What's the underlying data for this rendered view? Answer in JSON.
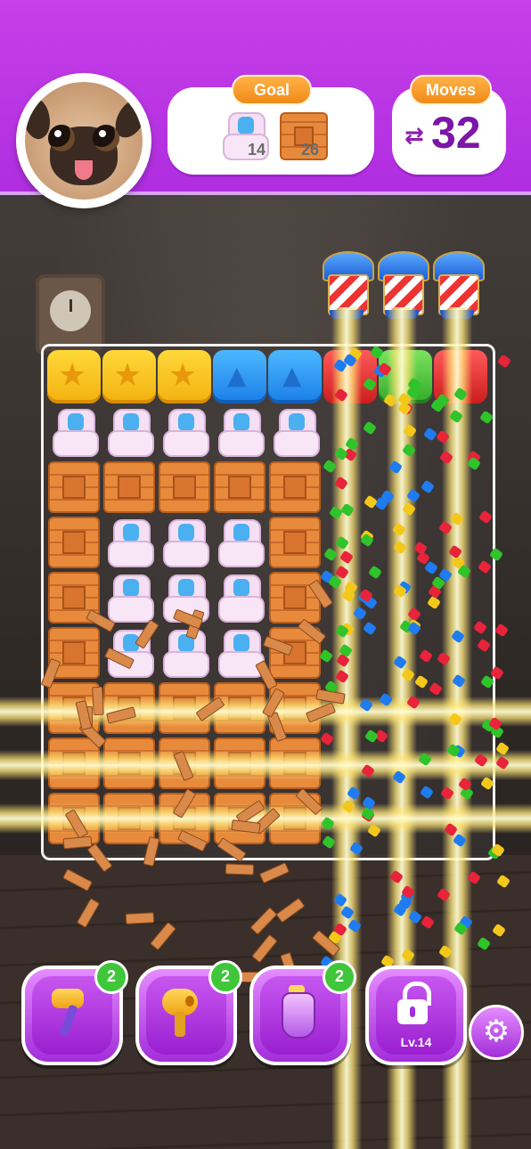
{
  "header": {
    "goal_label": "Goal",
    "goals": [
      {
        "icon": "armchair-icon",
        "count": "14"
      },
      {
        "icon": "crate-icon",
        "count": "26"
      }
    ],
    "moves_label": "Moves",
    "moves_icon": "swap-arrows-icon",
    "moves_value": "32",
    "avatar": "pug-avatar"
  },
  "boosters": [
    {
      "icon": "hammer-icon",
      "count": "2"
    },
    {
      "icon": "hair-dryer-icon",
      "count": "2"
    },
    {
      "icon": "vacuum-icon",
      "count": "2"
    },
    {
      "icon": "lock-icon",
      "label": "Lv.14"
    }
  ],
  "settings_icon": "gear-icon",
  "board_rows": [
    [
      "star",
      "star",
      "star",
      "bell",
      "bell",
      "red",
      "green",
      "red"
    ],
    [
      "chair",
      "chair",
      "chair",
      "chair",
      "chair",
      "",
      "",
      ""
    ],
    [
      "crate",
      "crate",
      "crate",
      "crate",
      "crate",
      "",
      "",
      ""
    ],
    [
      "crate",
      "chair",
      "chair",
      "chair",
      "crate",
      "",
      "",
      ""
    ],
    [
      "crate",
      "chair",
      "chair",
      "chair",
      "crate",
      "",
      "",
      ""
    ],
    [
      "crate",
      "chair",
      "chair",
      "chair",
      "crate",
      "",
      "",
      ""
    ],
    [
      "crate",
      "crate",
      "crate",
      "crate",
      "crate",
      "",
      "",
      ""
    ],
    [
      "crate",
      "crate",
      "crate",
      "crate",
      "crate",
      "",
      "",
      ""
    ],
    [
      "crate",
      "crate",
      "crate",
      "crate",
      "crate",
      "",
      "",
      ""
    ]
  ],
  "colors": {
    "header": "#b02ee0",
    "accent_orange": "#f08a18",
    "moves_text": "#7d16a8",
    "badge_green": "#3fc63a"
  }
}
